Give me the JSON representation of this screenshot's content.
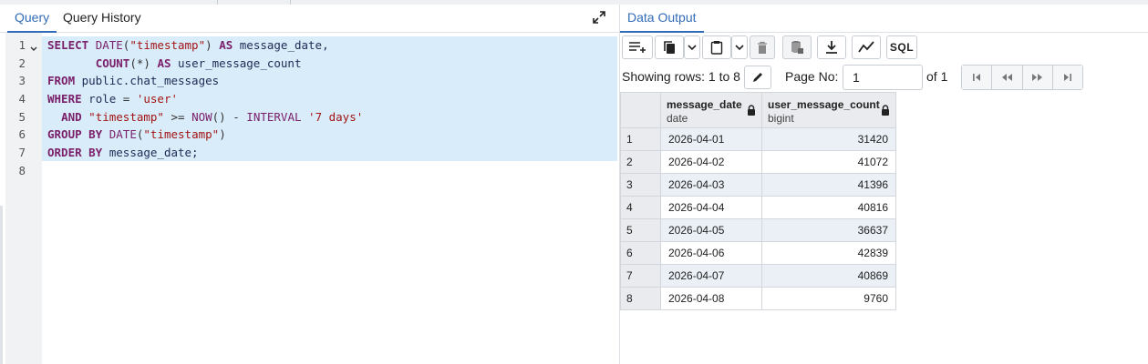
{
  "left_tabs": [
    {
      "label": "Query"
    },
    {
      "label": "Query History"
    }
  ],
  "editor": {
    "line_numbers": [
      "1",
      "2",
      "3",
      "4",
      "5",
      "6",
      "7",
      "8"
    ]
  },
  "right_tabs": [
    {
      "label": "Data Output"
    }
  ],
  "toolbar": {
    "sql_label": "SQL"
  },
  "pager": {
    "showing_text": "Showing rows: 1 to 8",
    "page_no_label": "Page No:",
    "page_value": "1",
    "of_text": "of 1"
  },
  "grid": {
    "columns": [
      {
        "name": "message_date",
        "type": "date"
      },
      {
        "name": "user_message_count",
        "type": "bigint"
      }
    ],
    "rows": [
      {
        "n": "1",
        "date": "2026-04-01",
        "count": "31420"
      },
      {
        "n": "2",
        "date": "2026-04-02",
        "count": "41072"
      },
      {
        "n": "3",
        "date": "2026-04-03",
        "count": "41396"
      },
      {
        "n": "4",
        "date": "2026-04-04",
        "count": "40816"
      },
      {
        "n": "5",
        "date": "2026-04-05",
        "count": "36637"
      },
      {
        "n": "6",
        "date": "2026-04-06",
        "count": "42839"
      },
      {
        "n": "7",
        "date": "2026-04-07",
        "count": "40869"
      },
      {
        "n": "8",
        "date": "2026-04-08",
        "count": "9760"
      }
    ]
  },
  "colors": {
    "accent": "#326bb8",
    "selection": "#d9ecf9",
    "keyword": "#7a1f6a",
    "string": "#a31515"
  }
}
